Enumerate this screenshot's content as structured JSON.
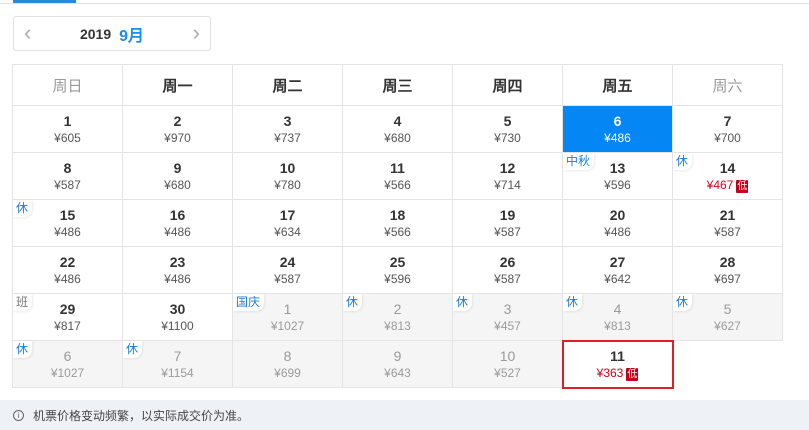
{
  "nav": {
    "year": "2019",
    "month": "9月",
    "prev": "‹",
    "next": "›"
  },
  "weekdays": [
    "周日",
    "周一",
    "周二",
    "周三",
    "周四",
    "周五",
    "周六"
  ],
  "weeks": [
    [
      {
        "day": "1",
        "price": "¥605"
      },
      {
        "day": "2",
        "price": "¥970"
      },
      {
        "day": "3",
        "price": "¥737"
      },
      {
        "day": "4",
        "price": "¥680"
      },
      {
        "day": "5",
        "price": "¥730"
      },
      {
        "day": "6",
        "price": "¥486",
        "selected": true
      },
      {
        "day": "7",
        "price": "¥700"
      }
    ],
    [
      {
        "day": "8",
        "price": "¥587"
      },
      {
        "day": "9",
        "price": "¥680"
      },
      {
        "day": "10",
        "price": "¥780"
      },
      {
        "day": "11",
        "price": "¥566"
      },
      {
        "day": "12",
        "price": "¥714"
      },
      {
        "day": "13",
        "price": "¥596",
        "tag": "中秋"
      },
      {
        "day": "14",
        "price": "¥467",
        "tag": "休",
        "low": true
      }
    ],
    [
      {
        "day": "15",
        "price": "¥486",
        "tag": "休"
      },
      {
        "day": "16",
        "price": "¥486"
      },
      {
        "day": "17",
        "price": "¥634"
      },
      {
        "day": "18",
        "price": "¥566"
      },
      {
        "day": "19",
        "price": "¥587"
      },
      {
        "day": "20",
        "price": "¥486"
      },
      {
        "day": "21",
        "price": "¥587"
      }
    ],
    [
      {
        "day": "22",
        "price": "¥486"
      },
      {
        "day": "23",
        "price": "¥486"
      },
      {
        "day": "24",
        "price": "¥587"
      },
      {
        "day": "25",
        "price": "¥596"
      },
      {
        "day": "26",
        "price": "¥587"
      },
      {
        "day": "27",
        "price": "¥642"
      },
      {
        "day": "28",
        "price": "¥697"
      }
    ],
    [
      {
        "day": "29",
        "price": "¥817",
        "tag": "班"
      },
      {
        "day": "30",
        "price": "¥1100"
      },
      {
        "day": "1",
        "price": "¥1027",
        "tag": "国庆",
        "muted": true
      },
      {
        "day": "2",
        "price": "¥813",
        "tag": "休",
        "muted": true
      },
      {
        "day": "3",
        "price": "¥457",
        "tag": "休",
        "muted": true
      },
      {
        "day": "4",
        "price": "¥813",
        "tag": "休",
        "muted": true
      },
      {
        "day": "5",
        "price": "¥627",
        "tag": "休",
        "muted": true
      }
    ],
    [
      {
        "day": "6",
        "price": "¥1027",
        "tag": "休",
        "muted": true
      },
      {
        "day": "7",
        "price": "¥1154",
        "tag": "休",
        "muted": true
      },
      {
        "day": "8",
        "price": "¥699",
        "muted": true
      },
      {
        "day": "9",
        "price": "¥643",
        "muted": true
      },
      {
        "day": "10",
        "price": "¥527",
        "muted": true
      },
      {
        "day": "11",
        "price": "¥363",
        "low": true,
        "highlighted": true
      },
      null
    ]
  ],
  "low_badge": "低",
  "footer": {
    "icon": "i",
    "text": "机票价格变动频繁，以实际成交价为准。"
  }
}
